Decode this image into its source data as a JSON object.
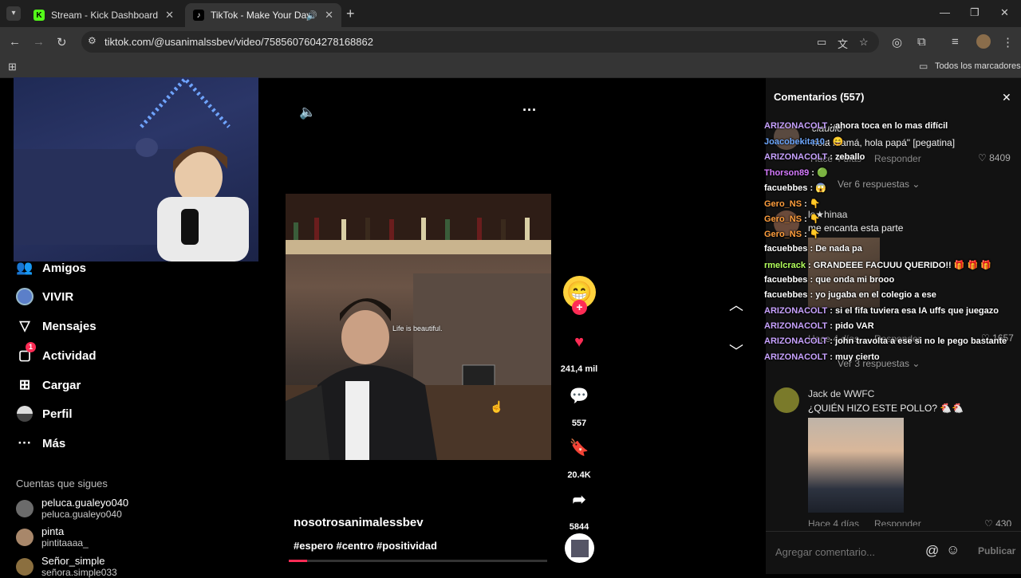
{
  "tabs": [
    {
      "title": "Stream - Kick Dashboard",
      "favicon": "K"
    },
    {
      "title": "TikTok - Make Your Day",
      "favicon": "♪"
    }
  ],
  "window": {
    "minimize": "—",
    "maximize": "❐",
    "close": "✕"
  },
  "address": {
    "url": "tiktok.com/@usanimalssbev/video/7585607604278168862"
  },
  "bookmarks": {
    "all_label": "Todos los marcadores"
  },
  "sidebar": {
    "items": [
      {
        "label": "Amigos",
        "icon": "friends-icon"
      },
      {
        "label": "VIVIR",
        "icon": "live-avatar-icon"
      },
      {
        "label": "Mensajes",
        "icon": "send-icon"
      },
      {
        "label": "Actividad",
        "icon": "activity-icon",
        "badge": "1"
      },
      {
        "label": "Cargar",
        "icon": "upload-icon"
      },
      {
        "label": "Perfil",
        "icon": "profile-icon"
      },
      {
        "label": "Más",
        "icon": "more-icon"
      }
    ],
    "following_title": "Cuentas que sigues",
    "following": [
      {
        "name": "peluca.gualeyo040",
        "handle": "peluca.gualeyo040"
      },
      {
        "name": "pinta",
        "handle": "pintitaaaa_"
      },
      {
        "name": "Señor_simple",
        "handle": "señora.simple033"
      }
    ]
  },
  "video": {
    "caption_overlay": "Life is beautiful.",
    "author": "nosotrosanimalessbev",
    "hashtags": "#espero #centro #positividad",
    "progress": 0.07
  },
  "actions": {
    "likes": "241,4 mil",
    "comments": "557",
    "saves": "20.4K",
    "shares": "5844"
  },
  "comments_panel": {
    "title": "Comentarios (557)",
    "reply_label": "Responder",
    "items": [
      {
        "user": "claudio",
        "text": "hola mamá, hola papá\" [pegatina]",
        "time": "Hace 4 días",
        "likes": "8409",
        "replies": "Ver 6 respuestas"
      },
      {
        "user": "lo★hinaa",
        "text": "me encanta esta parte",
        "time": "Hace 4 días",
        "likes": "1657",
        "replies": "Ver 3 respuestas"
      },
      {
        "user": "Jack de WWFC",
        "text": "¿QUIÉN HIZO ESTE POLLO? 🐔🐔",
        "time": "Hace 4 días",
        "likes": "430"
      }
    ],
    "input_placeholder": "Agregar comentario...",
    "post_label": "Publicar"
  },
  "chat_overlay": [
    {
      "user": "ARIZONACOLT",
      "msg": ": ahora toca en lo mas difícil",
      "color": "#c8a2ff"
    },
    {
      "user": "Joacobekita10",
      "msg": ": 😄",
      "color": "#6ea8ff"
    },
    {
      "user": "ARIZONACOLT",
      "msg": ": zeballo",
      "color": "#c8a2ff"
    },
    {
      "user": "Thorson89",
      "msg": ": 🟢",
      "color": "#d67bff"
    },
    {
      "user": "facuebbes",
      "msg": ": 😱",
      "color": "#ffffff"
    },
    {
      "user": "Gero_NS",
      "msg": ": 👇",
      "color": "#ff9e3d"
    },
    {
      "user": "Gero_NS",
      "msg": ": 👇",
      "color": "#ff9e3d"
    },
    {
      "user": "Gero_NS",
      "msg": ": 👇",
      "color": "#ff9e3d"
    },
    {
      "user": "facuebbes",
      "msg": ": De nada pa",
      "color": "#ffffff"
    },
    {
      "user": "rmelcrack",
      "msg": ": GRANDEEE FACUUU QUERIDO!! 🎁 🎁 🎁",
      "color": "#b3ff5c"
    },
    {
      "user": "facuebbes",
      "msg": ": que onda mi brooo",
      "color": "#ffffff"
    },
    {
      "user": "facuebbes",
      "msg": ": yo jugaba en el colegio a ese",
      "color": "#ffffff"
    },
    {
      "user": "ARIZONACOLT",
      "msg": ": si el fifa tuviera esa IA uffs que juegazo",
      "color": "#c8a2ff"
    },
    {
      "user": "ARIZONACOLT",
      "msg": ": pido VAR",
      "color": "#c8a2ff"
    },
    {
      "user": "ARIZONACOLT",
      "msg": ": john travolta a ese si no le pego bastante",
      "color": "#c8a2ff"
    },
    {
      "user": "ARIZONACOLT",
      "msg": ": muy cierto",
      "color": "#c8a2ff"
    }
  ],
  "colors": {
    "accent": "#fe2c55",
    "kick": "#53fc18"
  }
}
